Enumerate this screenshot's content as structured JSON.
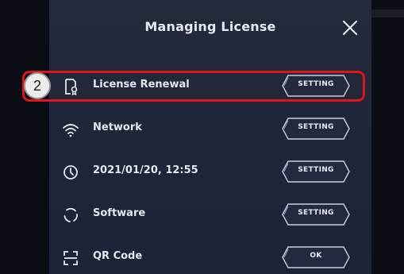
{
  "dialog": {
    "title": "Managing License",
    "close_icon": "close-icon"
  },
  "rows": [
    {
      "icon": "license-icon",
      "label": "License Renewal",
      "button_label": "SETTING"
    },
    {
      "icon": "wifi-icon",
      "label": "Network",
      "button_label": "SETTING"
    },
    {
      "icon": "clock-icon",
      "label": "2021/01/20, 12:55",
      "button_label": "SETTING"
    },
    {
      "icon": "software-icon",
      "label": "Software",
      "button_label": "SETTING"
    },
    {
      "icon": "qr-code-icon",
      "label": "QR Code",
      "button_label": "OK"
    }
  ],
  "annotation": {
    "step_number": "2",
    "highlight_color": "#e0141e"
  },
  "colors": {
    "dialog_background": "#22283a",
    "button_border": "#c8cee0",
    "text": "#e2e6ef"
  }
}
